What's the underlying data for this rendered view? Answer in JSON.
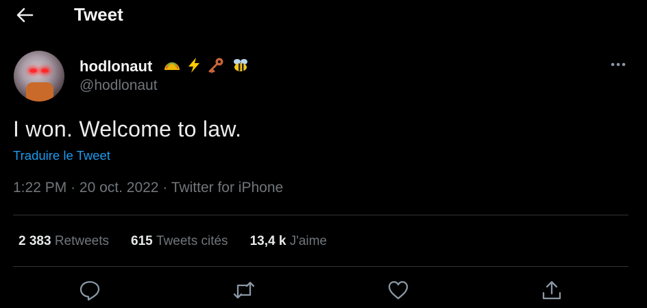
{
  "header": {
    "title": "Tweet",
    "back_icon": "arrow-left-icon"
  },
  "author": {
    "display_name": "hodlonaut",
    "handle": "@hodlonaut",
    "emojis": [
      "taco-emoji",
      "lightning-emoji",
      "key-emoji",
      "bee-emoji"
    ]
  },
  "tweet": {
    "text": "I won. Welcome to law.",
    "translate_label": "Traduire le Tweet",
    "timestamp": "1:22 PM",
    "date": "20 oct. 2022",
    "source": "Twitter for iPhone"
  },
  "stats": {
    "retweets_count": "2 383",
    "retweets_label": "Retweets",
    "quotes_count": "615",
    "quotes_label": "Tweets cités",
    "likes_count": "13,4 k",
    "likes_label": "J'aime"
  },
  "actions": [
    "reply-icon",
    "retweet-icon",
    "like-icon",
    "share-icon"
  ],
  "colors": {
    "background": "#000000",
    "text": "#e7e9ea",
    "muted": "#71767b",
    "link": "#1d9bf0",
    "divider": "#2f3336"
  }
}
